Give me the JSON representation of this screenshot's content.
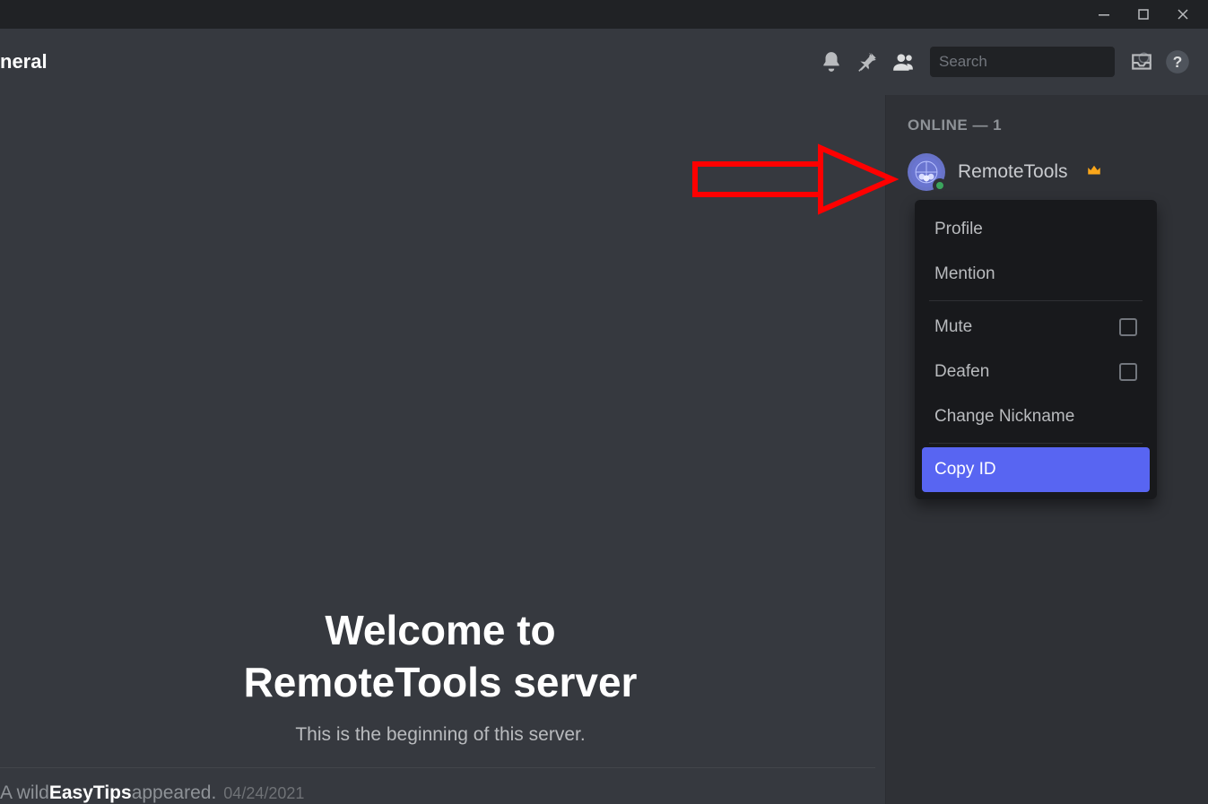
{
  "window": {
    "channel_name": "neral"
  },
  "header": {
    "search_placeholder": "Search"
  },
  "welcome": {
    "line1": "Welcome to",
    "line2": "RemoteTools server",
    "subtitle": "This is the beginning of this server."
  },
  "system_message": {
    "prefix": "A wild ",
    "name": "EasyTips",
    "suffix": " appeared.",
    "timestamp": "04/24/2021"
  },
  "members": {
    "group_label": "ONLINE — 1",
    "user": {
      "name": "RemoteTools"
    }
  },
  "context_menu": {
    "profile": "Profile",
    "mention": "Mention",
    "mute": "Mute",
    "deafen": "Deafen",
    "change_nickname": "Change Nickname",
    "copy_id": "Copy ID"
  }
}
